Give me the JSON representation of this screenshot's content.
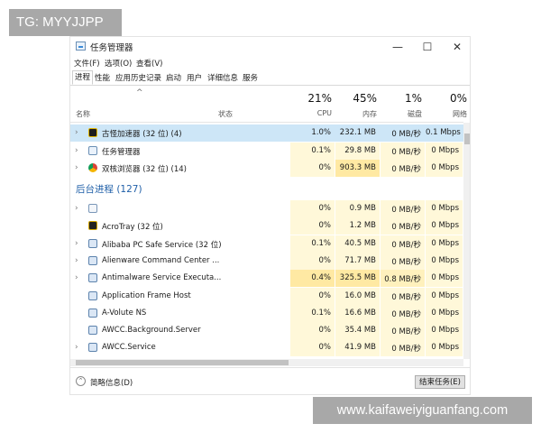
{
  "watermarks": {
    "top_left": "TG: MYYJJPP",
    "bottom_right": "www.kaifaweiyiguanfang.com"
  },
  "window": {
    "title": "任务管理器",
    "minimize_icon": "—",
    "maximize_icon": "☐",
    "close_icon": "✕"
  },
  "menu": [
    "文件(F)",
    "选项(O)",
    "查看(V)"
  ],
  "tabs": [
    "进程",
    "性能",
    "应用历史记录",
    "启动",
    "用户",
    "详细信息",
    "服务"
  ],
  "header": {
    "name": "名称",
    "status": "状态",
    "columns": [
      {
        "pct": "21%",
        "label": "CPU"
      },
      {
        "pct": "45%",
        "label": "内存"
      },
      {
        "pct": "1%",
        "label": "磁盘"
      },
      {
        "pct": "0%",
        "label": "网络"
      }
    ]
  },
  "colors": {
    "cell_light": "#fff8d9",
    "cell_mid": "#fff1bd",
    "cell_strong": "#ffe9a3",
    "selected": "#cde6f7",
    "section": "#1f5fa8"
  },
  "apps": [
    {
      "name": "古怪加速器 (32 位) (4)",
      "cpu": "1.0%",
      "mem": "232.1 MB",
      "disk": "0 MB/秒",
      "net": "0.1 Mbps",
      "icon": "accelerator-icon",
      "selected": true
    },
    {
      "name": "任务管理器",
      "cpu": "0.1%",
      "mem": "29.8 MB",
      "disk": "0 MB/秒",
      "net": "0 Mbps",
      "icon": "task-manager-icon"
    },
    {
      "name": "双核浏览器 (32 位) (14)",
      "cpu": "0%",
      "mem": "903.3 MB",
      "disk": "0 MB/秒",
      "net": "0 Mbps",
      "icon": "browser-icon"
    }
  ],
  "background_section": "后台进程 (127)",
  "background": [
    {
      "name": "",
      "cpu": "0%",
      "mem": "0.9 MB",
      "disk": "0 MB/秒",
      "net": "0 Mbps",
      "icon": "blank-service-icon",
      "chev": true
    },
    {
      "name": "AcroTray (32 位)",
      "cpu": "0%",
      "mem": "1.2 MB",
      "disk": "0 MB/秒",
      "net": "0 Mbps",
      "icon": "acrotray-icon",
      "chev": false
    },
    {
      "name": "Alibaba PC Safe Service (32 位)",
      "cpu": "0.1%",
      "mem": "40.5 MB",
      "disk": "0 MB/秒",
      "net": "0 Mbps",
      "icon": "service-icon",
      "chev": true
    },
    {
      "name": "Alienware Command Center ...",
      "cpu": "0%",
      "mem": "71.7 MB",
      "disk": "0 MB/秒",
      "net": "0 Mbps",
      "icon": "service-icon",
      "chev": true
    },
    {
      "name": "Antimalware Service Executa...",
      "cpu": "0.4%",
      "mem": "325.5 MB",
      "disk": "0.8 MB/秒",
      "net": "0 Mbps",
      "icon": "service-icon",
      "chev": true
    },
    {
      "name": "Application Frame Host",
      "cpu": "0%",
      "mem": "16.0 MB",
      "disk": "0 MB/秒",
      "net": "0 Mbps",
      "icon": "service-icon",
      "chev": false
    },
    {
      "name": "A-Volute NS",
      "cpu": "0.1%",
      "mem": "16.6 MB",
      "disk": "0 MB/秒",
      "net": "0 Mbps",
      "icon": "service-icon",
      "chev": false
    },
    {
      "name": "AWCC.Background.Server",
      "cpu": "0%",
      "mem": "35.4 MB",
      "disk": "0 MB/秒",
      "net": "0 Mbps",
      "icon": "service-icon",
      "chev": false
    },
    {
      "name": "AWCC.Service",
      "cpu": "0%",
      "mem": "41.9 MB",
      "disk": "0 MB/秒",
      "net": "0 Mbps",
      "icon": "service-icon",
      "chev": true
    }
  ],
  "footer": {
    "less_details": "简略信息(D)",
    "less_icon": "⌃",
    "end_task": "结束任务(E)"
  }
}
